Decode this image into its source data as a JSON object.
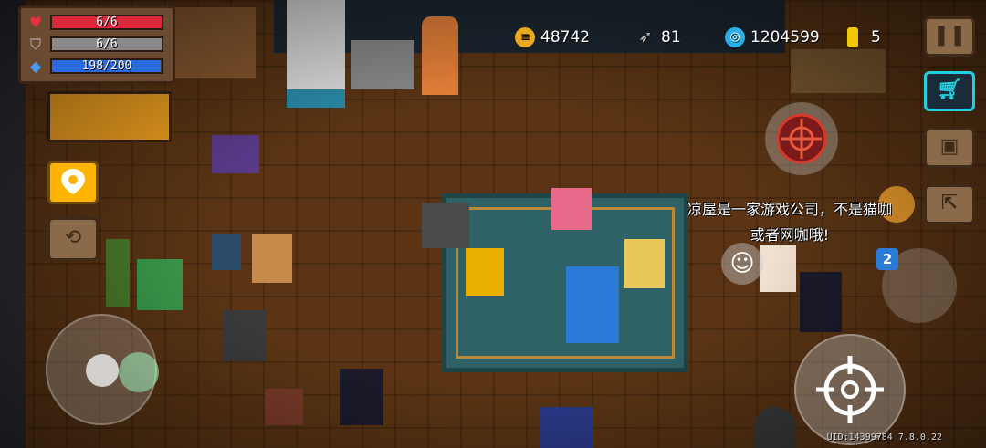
{
  "hud": {
    "hp": {
      "value": "6/6",
      "fill": 1.0,
      "color": "#d8283a",
      "icon": "heart-icon"
    },
    "armor": {
      "value": "6/6",
      "fill": 1.0,
      "color": "#8a8a8a",
      "icon": "shield-icon"
    },
    "energy": {
      "value": "198/200",
      "fill": 0.99,
      "color": "#2a6ae0",
      "icon": "energy-crystal-icon"
    }
  },
  "currencies": {
    "gold": {
      "value": "48742",
      "icon": "gold-coin-icon"
    },
    "fish": {
      "value": "81",
      "icon": "fish-icon"
    },
    "gems": {
      "value": "1204599",
      "icon": "gem-icon"
    },
    "tokens": {
      "value": "5",
      "icon": "gold-token-icon"
    }
  },
  "buttons": {
    "pause": {
      "icon": "pause-icon"
    },
    "shop": {
      "icon": "shopping-cart-icon"
    },
    "profile": {
      "icon": "profile-card-icon"
    },
    "exit": {
      "icon": "exit-door-icon"
    },
    "map": {
      "icon": "location-pin-icon"
    },
    "swap": {
      "icon": "swap-character-icon"
    },
    "skill": {
      "icon": "crosshair-skill-icon"
    },
    "emote": {
      "icon": "smiley-icon"
    },
    "attack": {
      "icon": "crosshair-icon"
    }
  },
  "weapon": {
    "slot_badge": "2"
  },
  "chat": {
    "line1": "凉屋是一家游戏公司，不是猫咖",
    "line2": "或者网咖哦!"
  },
  "footer": {
    "uid": "UID:14399784 7.8.0.22"
  },
  "colors": {
    "floor": "#5a3414",
    "rug": "#2e6266",
    "shop_accent": "#20d0e0",
    "map_button": "#ffb400"
  }
}
